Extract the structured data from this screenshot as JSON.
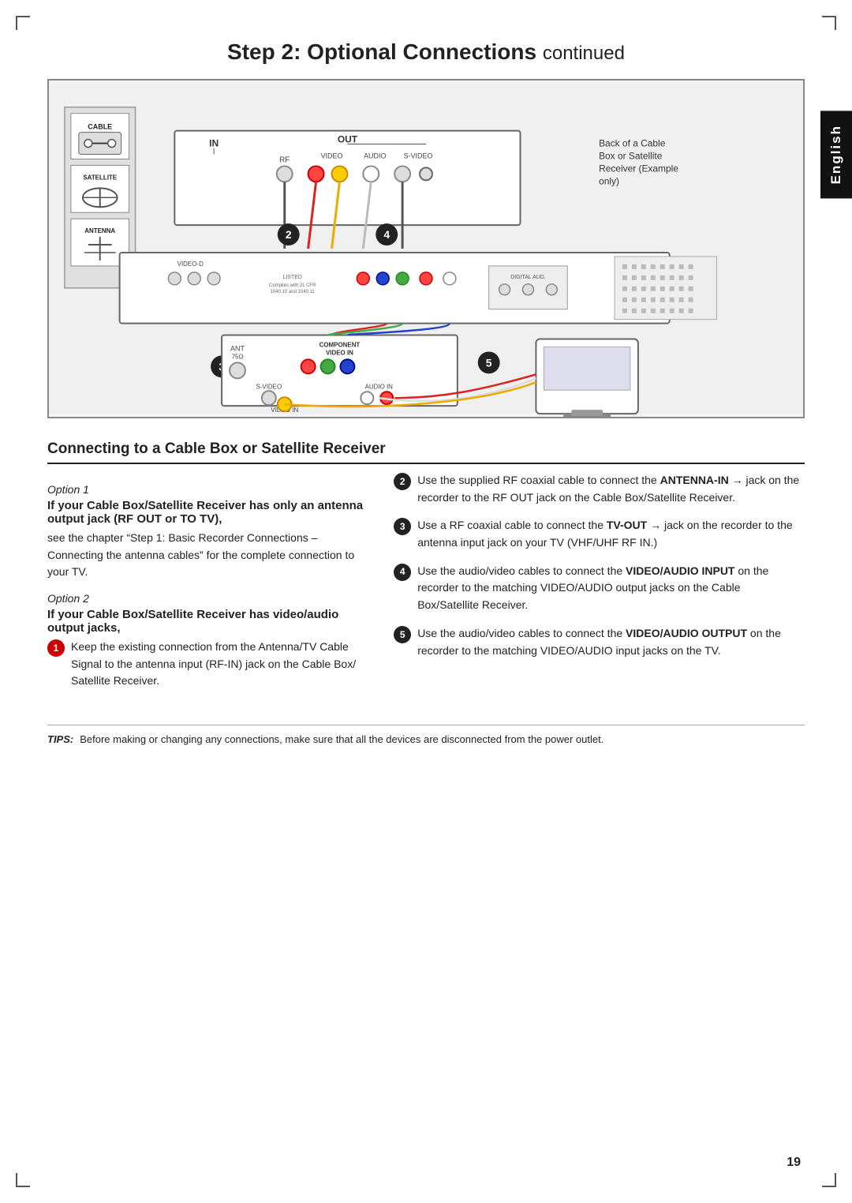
{
  "page": {
    "title": "Step 2: Optional Connections",
    "title_suffix": "continued",
    "page_number": "19",
    "english_tab": "English"
  },
  "diagram": {
    "back_label_line1": "Back of a Cable",
    "back_label_line2": "Box or Satellite",
    "back_label_line3": "Receiver (Example",
    "back_label_line4": "only)"
  },
  "section": {
    "heading": "Connecting to a Cable Box or Satellite Receiver"
  },
  "option1": {
    "label": "Option 1",
    "bold_heading": "If your Cable Box/Satellite Receiver has only an antenna output jack (RF OUT or TO TV),",
    "text": "see the chapter “Step 1: Basic Recorder Connections – Connecting the antenna cables” for the complete connection to your TV."
  },
  "option2": {
    "label": "Option 2",
    "bold_heading": "If your Cable Box/Satellite Receiver has video/audio output jacks,"
  },
  "right_col": {
    "item2": {
      "number": "2",
      "text_before": "Use the supplied RF coaxial cable to connect the ",
      "bold": "ANTENNA-IN",
      "arrow": "→",
      "text_after": " jack on the recorder to the RF OUT jack on the Cable Box/Satellite Receiver."
    },
    "item3": {
      "number": "3",
      "text_before": "Use a RF coaxial cable to connect the ",
      "bold": "TV-OUT",
      "arrow": "→",
      "text_after": " jack on the recorder to the antenna input jack on your TV (VHF/UHF RF IN.)"
    },
    "item4": {
      "number": "4",
      "text_before": "Use the audio/video cables to connect the ",
      "bold": "VIDEO/AUDIO INPUT",
      "text_after": " on the recorder to the matching VIDEO/AUDIO output jacks on the Cable Box/Satellite Receiver."
    },
    "item5": {
      "number": "5",
      "text_before": "Use the audio/video cables to connect the ",
      "bold": "VIDEO/AUDIO OUTPUT",
      "text_after": " on the recorder to the matching VIDEO/AUDIO input jacks on the TV."
    }
  },
  "option2_step1": {
    "number": "1",
    "text": "Keep the existing connection from the Antenna/TV Cable Signal to the antenna input (RF-IN) jack on the Cable Box/ Satellite Receiver."
  },
  "tips": {
    "label": "TIPS:",
    "text": "Before making or changing any connections, make sure that all the devices are disconnected from the power outlet."
  }
}
